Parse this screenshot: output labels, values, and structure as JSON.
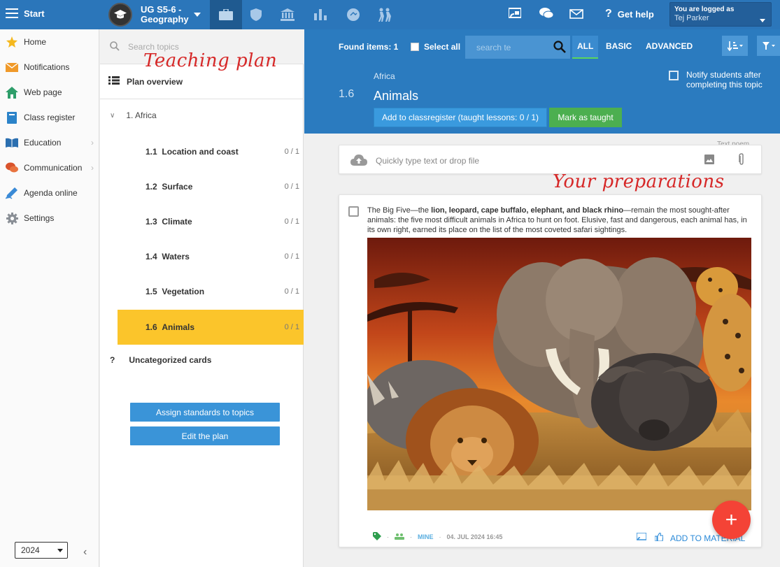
{
  "topbar": {
    "start_label": "Start",
    "course_line1": "UG S5-6 -",
    "course_line2": "Geography",
    "help_label": "Get help",
    "user_caption": "You are logged as",
    "user_name": "Tej Parker",
    "bg_color": "#2b76ba"
  },
  "leftnav": {
    "items": [
      {
        "label": "Home",
        "icon": "star-icon"
      },
      {
        "label": "Notifications",
        "icon": "envelope-icon"
      },
      {
        "label": "Web page",
        "icon": "house-icon"
      },
      {
        "label": "Class register",
        "icon": "book-icon"
      },
      {
        "label": "Education",
        "icon": "open-book-icon"
      },
      {
        "label": "Communication",
        "icon": "chat-icon"
      },
      {
        "label": "Agenda online",
        "icon": "pen-icon"
      },
      {
        "label": "Settings",
        "icon": "gear-icon"
      }
    ],
    "year": "2024"
  },
  "plan": {
    "search_placeholder": "Search topics",
    "handwritten_label": "Teaching plan",
    "overview_label": "Plan overview",
    "chapter": "1. Africa",
    "topics": [
      {
        "num": "1.1",
        "title": "Location and coast",
        "count": "0 / 1"
      },
      {
        "num": "1.2",
        "title": "Surface",
        "count": "0 / 1"
      },
      {
        "num": "1.3",
        "title": "Climate",
        "count": "0 / 1"
      },
      {
        "num": "1.4",
        "title": "Waters",
        "count": "0 / 1"
      },
      {
        "num": "1.5",
        "title": "Vegetation",
        "count": "0 / 1"
      },
      {
        "num": "1.6",
        "title": "Animals",
        "count": "0 / 1"
      }
    ],
    "uncategorized_mark": "?",
    "uncategorized_label": "Uncategorized cards",
    "assign_button": "Assign standards to topics",
    "edit_button": "Edit the plan",
    "active_color": "#fbc52b"
  },
  "main": {
    "found_label": "Found items: 1",
    "select_all_label": "Select all",
    "search_placeholder": "search te",
    "tabs": [
      "ALL",
      "BASIC",
      "ADVANCED"
    ],
    "breadcrumb": "Africa",
    "topic_num": "1.6",
    "topic_title": "Animals",
    "add_classregister_button": "Add to classregister (taught lessons: 0 / 1)",
    "mark_taught_button": "Mark as taught",
    "notify_label": "Notify students after completing this topic",
    "text_poem_hint": "Text poem",
    "quick_placeholder": "Quickly type text or drop file",
    "handwritten_label": "Your preparations",
    "card": {
      "text_before": "The Big Five—the ",
      "text_bold": "lion, leopard, cape buffalo, elephant, and black rhino",
      "text_after": "—remain the most sought-after animals: the five most difficult animals in Africa to hunt on foot. Elusive, fast and dangerous, each animal has, in its own right, earned its place on the list of the most coveted safari sightings.",
      "owner_label": "MINE",
      "date": "04. JUL 2024 16:45",
      "add_material_label": "ADD TO MATERIAL",
      "dot": "·"
    },
    "fab_label": "+",
    "header_color": "#2b7bbf"
  }
}
